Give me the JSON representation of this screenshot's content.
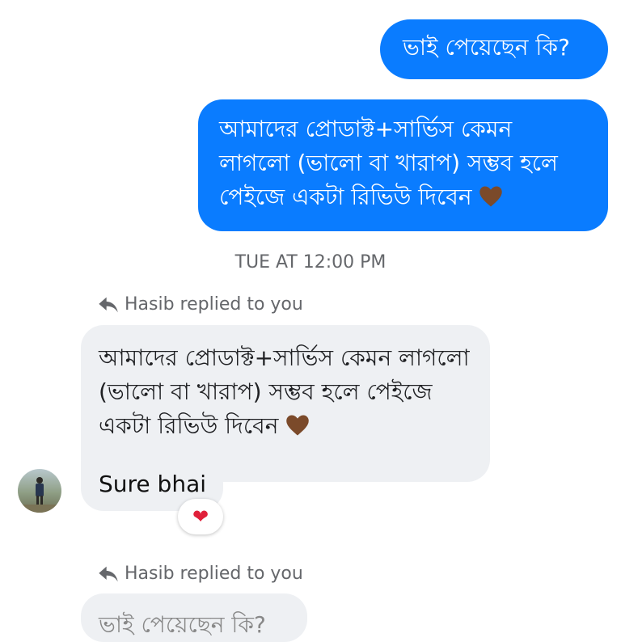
{
  "outgoing": [
    {
      "text": "ভাই পেয়েছেন কি?"
    },
    {
      "text": "আমাদের প্রোডাক্ট+সার্ভিস কেমন লাগলো (ভালো বা খারাপ) সম্ভব হলে পেইজে একটা রিভিউ দিবেন",
      "emoji": "brown-heart"
    }
  ],
  "timestamp": "TUE AT 12:00 PM",
  "replies": [
    {
      "replied_label": "Hasib replied to you",
      "quoted_text": "আমাদের প্রোডাক্ট+সার্ভিস কেমন লাগলো (ভালো বা খারাপ) সম্ভব হলে পেইজে একটা রিভিউ দিবেন",
      "reply_text": "Sure bhai",
      "reaction": "❤"
    },
    {
      "replied_label": "Hasib replied to you",
      "quoted_text": "ভাই পেয়েছেন কি?"
    }
  ],
  "colors": {
    "outgoing": "#0a7cff",
    "incoming": "#eef0f3",
    "muted": "#65676b"
  }
}
